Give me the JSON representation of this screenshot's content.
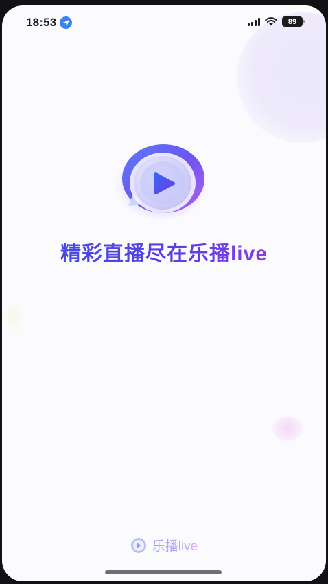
{
  "status_bar": {
    "time": "18:53",
    "battery_level": "89",
    "icons": [
      "location-arrow-icon",
      "signal-icon",
      "wifi-icon",
      "battery-icon"
    ]
  },
  "splash": {
    "logo_icon": "play-bubble-icon",
    "slogan": "精彩直播尽在乐播live"
  },
  "footer": {
    "brand_icon": "play-bubble-icon",
    "brand_text": "乐播live"
  },
  "colors": {
    "background": "#fbfbfe",
    "slogan_start": "#3d4fe0",
    "slogan_end": "#a23ae8",
    "location_badge": "#3a83f1",
    "footer_text": "#b7b0f0"
  }
}
